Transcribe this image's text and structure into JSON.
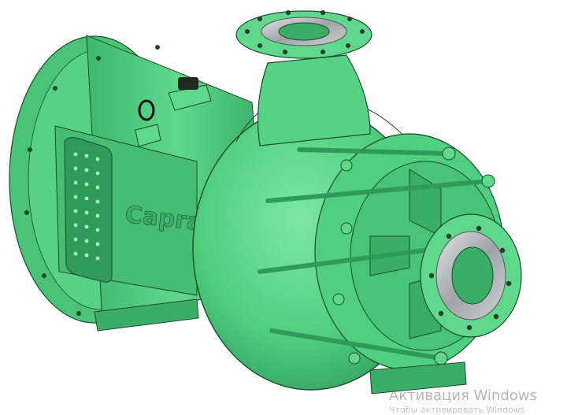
{
  "scene": {
    "subject": "centrifugal-pump-3d-model",
    "body_color": "#4fcf7f",
    "shadow_color": "#2f9a5a",
    "highlight_color": "#7fe6a6",
    "edge_color": "#1d4a2e",
    "flange_metal_color": "#b8bcc0",
    "bolt_color": "#2a3a2f"
  },
  "branding": {
    "cast_text": "Caprari"
  },
  "watermark": {
    "line1": "Активация Windows",
    "line2": "Чтобы активировать Windows"
  }
}
